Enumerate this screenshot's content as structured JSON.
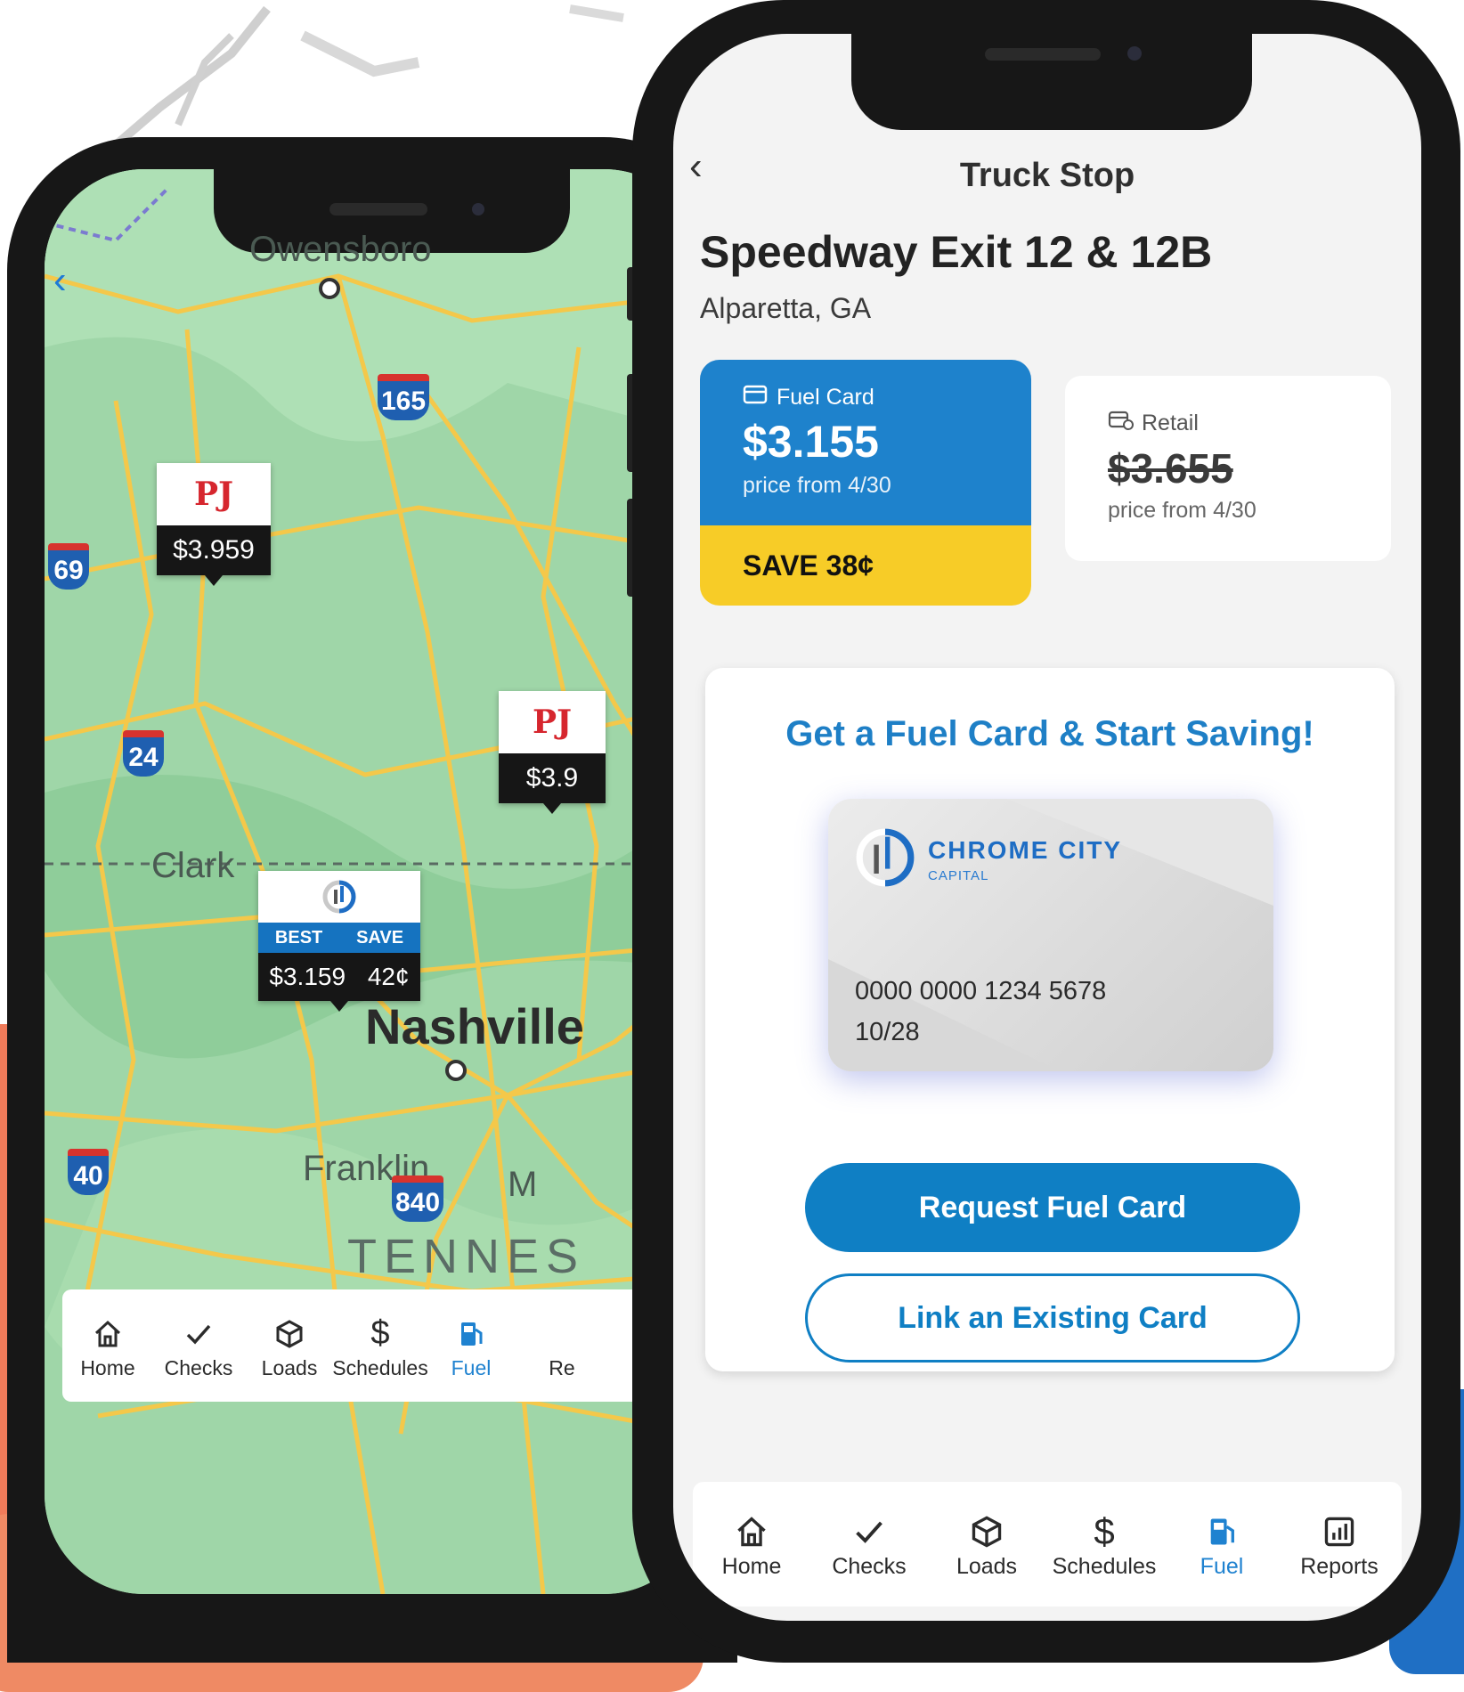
{
  "map_screen": {
    "cities": {
      "owensboro": "Owensboro",
      "clarksville": "Clark",
      "nashville": "Nashville",
      "franklin": "Franklin",
      "m_partial": "M",
      "tennessee": "TENNES"
    },
    "shields": [
      "165",
      "69",
      "24",
      "40",
      "840"
    ],
    "pins": [
      {
        "logo": "PJ",
        "price": "$3.959"
      },
      {
        "logo": "PJ",
        "price": "$3.9"
      }
    ],
    "best_pin": {
      "best_label": "BEST",
      "save_label": "SAVE",
      "price": "$3.159",
      "save": "42¢"
    },
    "tabbar": [
      {
        "label": "Home",
        "icon": "home-icon"
      },
      {
        "label": "Checks",
        "icon": "check-icon"
      },
      {
        "label": "Loads",
        "icon": "box-icon"
      },
      {
        "label": "Schedules",
        "icon": "dollar-icon"
      },
      {
        "label": "Fuel",
        "icon": "fuel-pump-icon",
        "active": true
      },
      {
        "label": "Re",
        "icon": "reports-icon"
      }
    ]
  },
  "detail_screen": {
    "nav_title": "Truck Stop",
    "station_name": "Speedway Exit 12 & 12B",
    "station_location": "Alparetta, GA",
    "fuel_card": {
      "label": "Fuel Card",
      "price": "$3.155",
      "subtitle": "price from 4/30",
      "savings": "SAVE 38¢"
    },
    "retail": {
      "label": "Retail",
      "price": "$3.655",
      "subtitle": "price from 4/30"
    },
    "promo": {
      "title": "Get a Fuel Card & Start Saving!",
      "card_brand": "CHROME CITY",
      "card_brand_sub": "CAPITAL",
      "card_number": "0000 0000 1234 5678",
      "card_expiry": "10/28",
      "request_button": "Request Fuel Card",
      "link_button": "Link an Existing Card"
    },
    "tabbar": [
      {
        "label": "Home",
        "icon": "home-icon"
      },
      {
        "label": "Checks",
        "icon": "check-icon"
      },
      {
        "label": "Loads",
        "icon": "box-icon"
      },
      {
        "label": "Schedules",
        "icon": "dollar-icon"
      },
      {
        "label": "Fuel",
        "icon": "fuel-pump-icon",
        "active": true
      },
      {
        "label": "Reports",
        "icon": "reports-icon"
      }
    ]
  },
  "colors": {
    "accent_blue": "#1e82cc",
    "save_yellow": "#f7cc27",
    "map_green": "#9fd6a8",
    "road_yellow": "#f4c84a",
    "pin_red": "#d6262e"
  }
}
